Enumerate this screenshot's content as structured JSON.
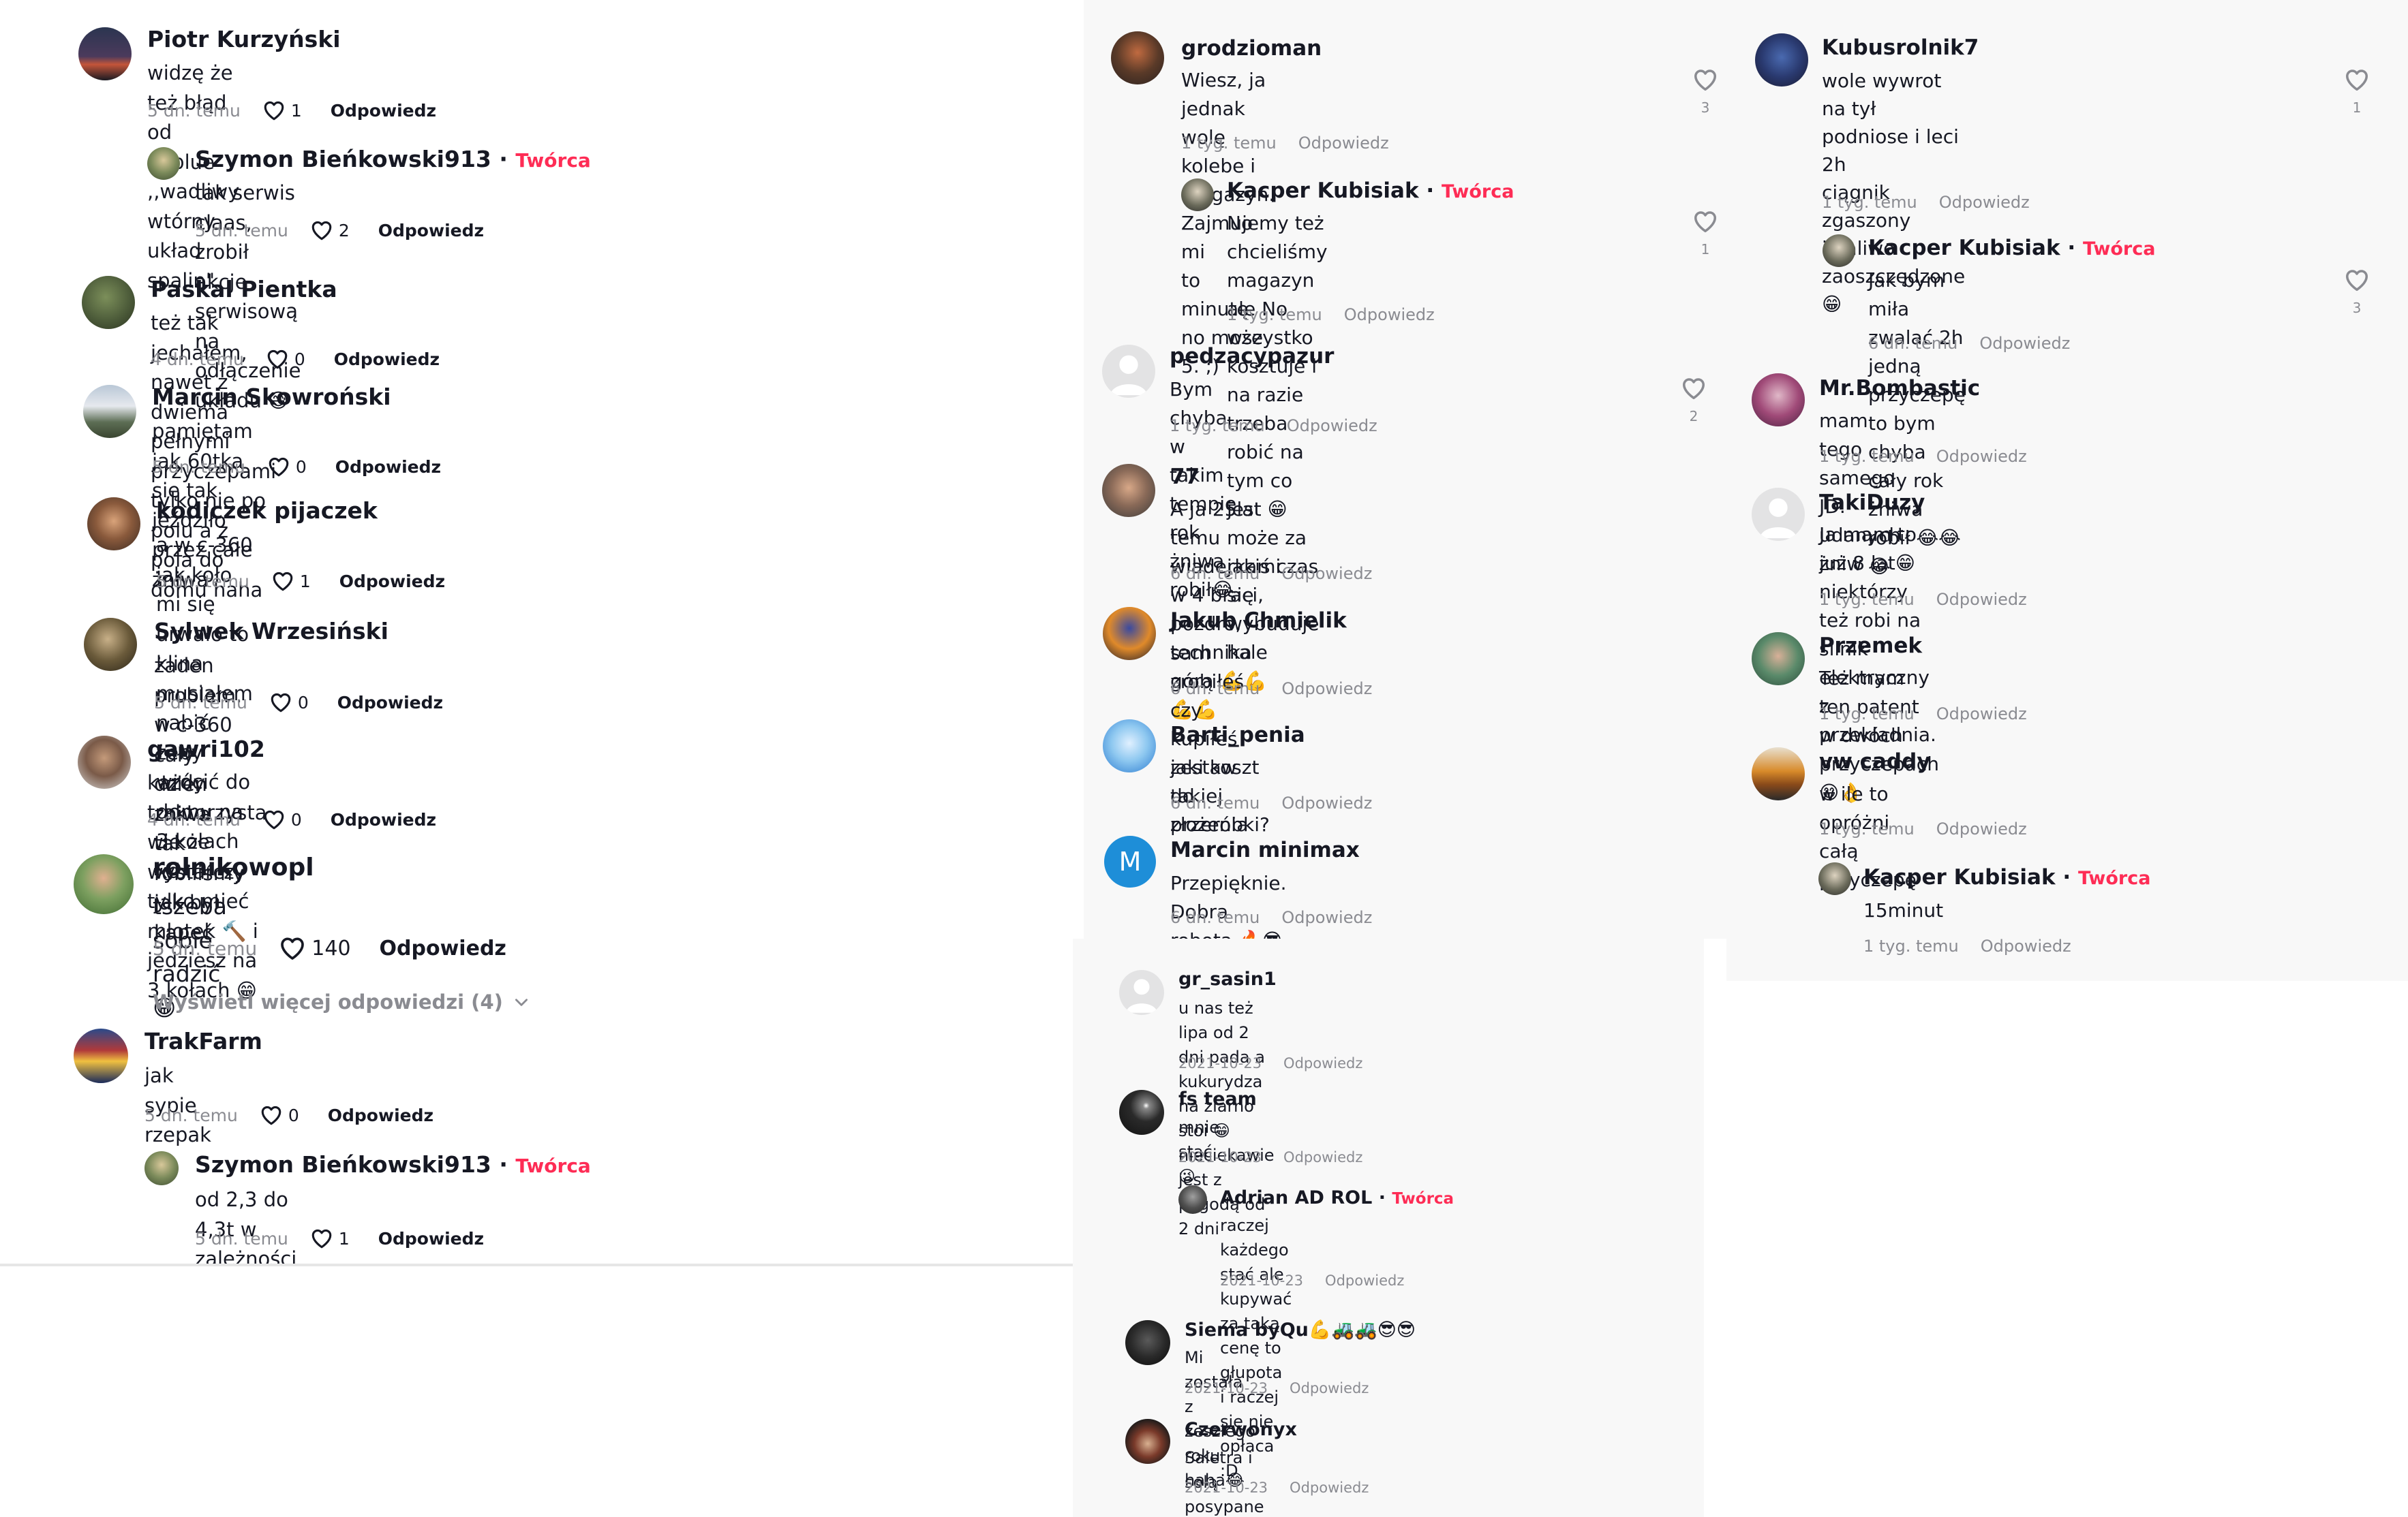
{
  "badge": "Twórca",
  "reply_label": "Odpowiedz",
  "panel1": {
    "comments": [
      {
        "name": "Piotr Kurzyński",
        "text": "widzę że też błąd od adblue ,,wadliwy wtórny układ spalin\"",
        "date": "5 dn. temu",
        "likes": "1"
      },
      {
        "name": "Szymon Bieńkowski913",
        "text": "tak serwis claas, zrobił akcje serwisową na odłączenie układu 😅",
        "date": "5 dn. temu",
        "likes": "2"
      },
      {
        "name": "Paskal Pientka",
        "text": "też tak jechałem, nawet z dwiema pełnymi przyczepami tylko nie po polu a z pola do domu haha",
        "date": "4 dn. temu",
        "likes": "0"
      },
      {
        "name": "Marcin Skowroński",
        "text": "pamiętam jak 60tka się tak jeździło przez całe żniwa",
        "date": "5 dn. temu",
        "likes": "0"
      },
      {
        "name": "kodiczek pijaczek",
        "text": "a w c-360 jak koło mi się urwało to klina musiałem nabić żeby wrócić do domu na 3 kołach xd",
        "date": "5 dn. temu",
        "likes": "1"
      },
      {
        "name": "Sylwek Wrzesiński",
        "text": "żaden problem. w c-360 cały dzien zniwa tak robiliśmy jak był kapeć",
        "date": "5 dn. temu",
        "likes": "0"
      },
      {
        "name": "gawri102",
        "text": "każdy traktorzysta wie że wystarczy tylko mieć młotek 🔨 i jedziesz na 3 kołach 😁",
        "date": "4 dn. temu",
        "likes": "0"
      },
      {
        "name": "rolnikowopl",
        "text": "tszeba sobie radzić 😁",
        "date": "5 dn. temu",
        "likes": "140"
      },
      {
        "name": "TrakFarm",
        "text": "jak sypie rzepak",
        "date": "5 dn. temu",
        "likes": "0"
      },
      {
        "name": "Szymon Bieńkowski913",
        "text": "od 2,3 do 4,3t w zależności od działki",
        "date": "5 dn. temu",
        "likes": "1"
      }
    ],
    "more_replies": "Wyświetl więcej odpowiedzi (4)"
  },
  "panel2": {
    "comments": [
      {
        "name": "grodzioman",
        "text": "Wiesz, ja jednak wolę kolebe i magazyn. Zajmuje mi\nto minutę. no może 5. ;)",
        "date": "1 tyg. temu",
        "likes": "3"
      },
      {
        "name": "Kacper Kubisiak",
        "text": "No my też chcieliśmy magazyn ale No wszystko\nkosztuje i na razie trzeba robić na tym co jest 😁\nmoże za jakiś czas się wybuduje hale",
        "date": "1 tyg. temu",
        "likes": "1"
      },
      {
        "name": "pedzacypazur",
        "text": "Bym chyba w takim tempie rok żniwa robił😂",
        "date": "1 tyg. temu",
        "likes": "2"
      },
      {
        "name": "77",
        "text": "A ja 25lat temu wiaderkami w 4 braci, pozdro,\ntechnika górą 💪💪💪💪",
        "date": "6 dn. temu"
      },
      {
        "name": "Jakub Chmielik",
        "text": "sam zrobiłeś czy kupiłeś zestaw do złożenia",
        "date": "6 dn. temu"
      },
      {
        "name": "Barti_penia",
        "text": "jaki koszt takiej przeróbki?",
        "date": "6 dn. temu"
      },
      {
        "name": "Marcin minimax",
        "text": "Przepięknie. Dobra robota 🔥😎👌",
        "date": "6 dn. temu",
        "initial": "M"
      }
    ]
  },
  "panel3": {
    "comments": [
      {
        "name": "Kubusrolnik7",
        "text": "wole wywrot na tył\npodniose i leci 2h\nciągnik zgaszony\ni paliwo zaoszczędzone😁",
        "date": "1 tyg. temu",
        "likes": "1"
      },
      {
        "name": "Kacper Kubisiak",
        "text": "Jak bym miła zwalać 2h jedną przyczepę to bym\nchyba cały rok żniwa robił 😂😂😂",
        "date": "6 dn. temu",
        "likes": "3"
      },
      {
        "name": "Mr.Bombastic",
        "text": "mam tego samego JD. udanych żniw",
        "date": "1 tyg. temu"
      },
      {
        "name": "TakiDuzy",
        "text": "Ja mam to już 8 lat😁 niektórzy też robi na silnik\nelektryczny z przekładnia.",
        "date": "1 tyg. temu"
      },
      {
        "name": "Przemek",
        "text": "Też mam ten patent w dwóch przyczepach😁👌",
        "date": "1 tyg. temu"
      },
      {
        "name": "vw caddy",
        "text": "w ile to opróżni całą przyczepę",
        "date": "1 tyg. temu"
      },
      {
        "name": "Kacper Kubisiak",
        "text": "15minut",
        "date": "1 tyg. temu"
      }
    ]
  },
  "panel4": {
    "comments": [
      {
        "name": "gr_sasin1",
        "text": "u nas też lipa od 2 dni pada a kukurydza na ziarno\nstoi 😁 nieciekawie jest z pogodą od 2 dni",
        "date": "2021-10-23"
      },
      {
        "name": "fs team",
        "text": "mnie stać 😉",
        "date": "2021-10-23"
      },
      {
        "name": "Adrian AD ROL",
        "text": "raczej każdego stać ale kupywać za taką cenę to\ngłupota i raczej się nie opłaca :D",
        "date": "2021-10-23"
      },
      {
        "name": "Siema byQu💪🚜🚜😎😎",
        "text": "Mi została z zeszłego roku haha😂",
        "date": "2021-10-23"
      },
      {
        "name": "Czerwonyx",
        "text": "Saletra i solą posypane",
        "date": "2021-10-23"
      }
    ]
  },
  "colors": {
    "accent": "#fe2c55",
    "meta": "#8a8b91",
    "text": "#161823",
    "blue_avatar": "#1e8ed8"
  }
}
